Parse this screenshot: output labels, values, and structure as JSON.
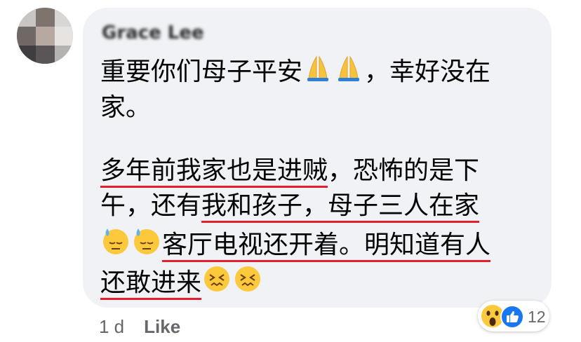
{
  "comment": {
    "author": "Grace Lee",
    "lines": [
      "重要你们母子平安",
      "，幸好没在",
      "家。",
      "多年前我家也是进贼",
      "，恐怖的是下",
      "午，还有",
      "我和孩子，母子三人在家",
      "客厅电视还开着。明知道有人",
      "还敢进来"
    ],
    "emojis": [
      "folded-hands",
      "folded-hands",
      "downcast-sweat",
      "downcast-sweat",
      "confounded",
      "confounded"
    ]
  },
  "meta": {
    "time": "1 d",
    "like_label": "Like"
  },
  "reactions": {
    "types": [
      "wow",
      "like"
    ],
    "count": "12"
  },
  "colors": {
    "bubble": "#f0f2f5",
    "underline": "#e41e2e",
    "meta_text": "#65676b",
    "like_blue": "#1877f2"
  }
}
